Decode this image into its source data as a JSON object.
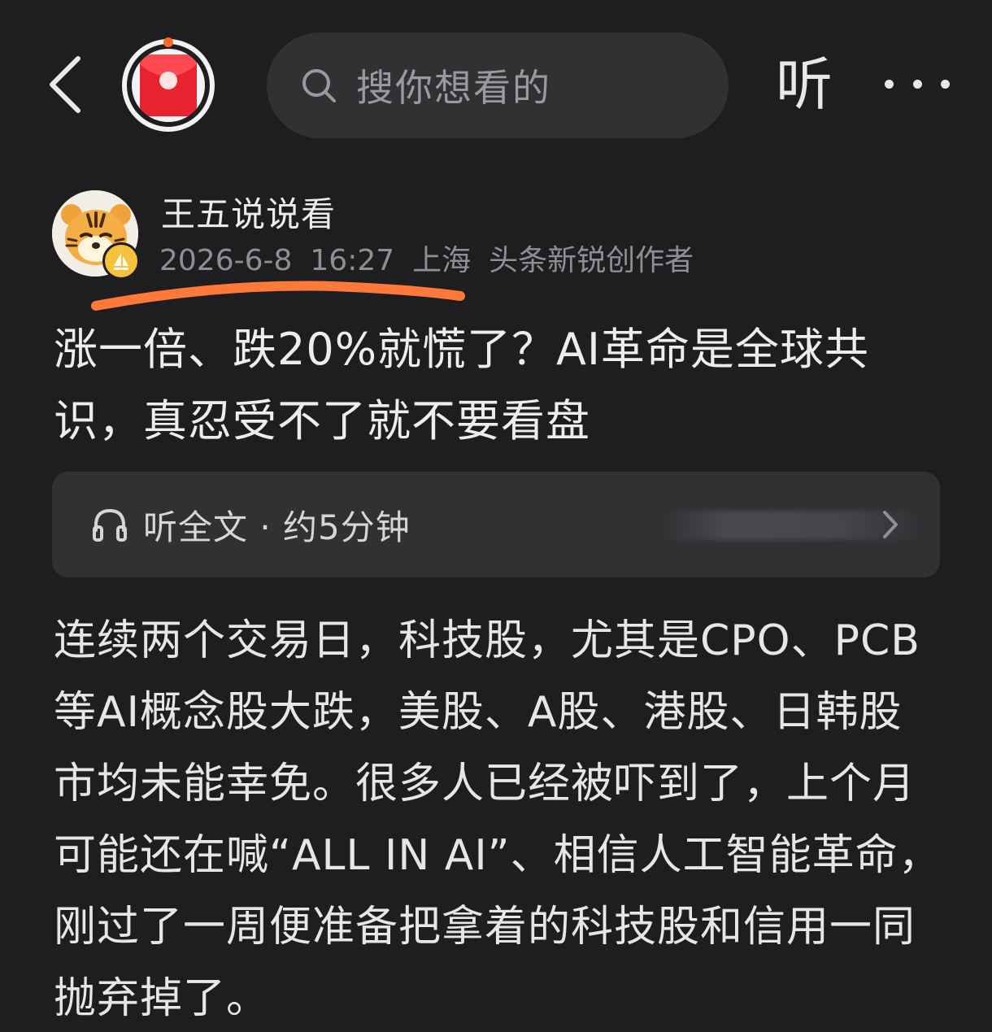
{
  "topbar": {
    "search_placeholder": "搜你想看的",
    "listen_label": "听"
  },
  "author": {
    "name": "王五说说看",
    "date": "2026-6-8",
    "time": "16:27",
    "location": "上海",
    "badge": "头条新锐创作者"
  },
  "article": {
    "title": "涨一倍、跌20%就慌了？AI革命是全球共识，真忍受不了就不要看盘",
    "listen_full": "听全文 · 约5分钟",
    "body": "连续两个交易日，科技股，尤其是CPO、PCB等AI概念股大跌，美股、A股、港股、日韩股市均未能幸免。很多人已经被吓到了，上个月可能还在喊“ALL IN AI”、相信人工智能革命，刚过了一周便准备把拿着的科技股和信用一同抛弃掉了。"
  },
  "colors": {
    "background": "#1e1e20",
    "panel": "#313134",
    "accent_red": "#e8232f",
    "highlight_orange": "#ff7a3a"
  },
  "icons": {
    "back": "chevron-left-icon",
    "redpack": "red-envelope-icon",
    "search": "search-icon",
    "more": "more-dots-icon",
    "headphones": "headphones-icon",
    "chevron": "chevron-right-icon"
  }
}
